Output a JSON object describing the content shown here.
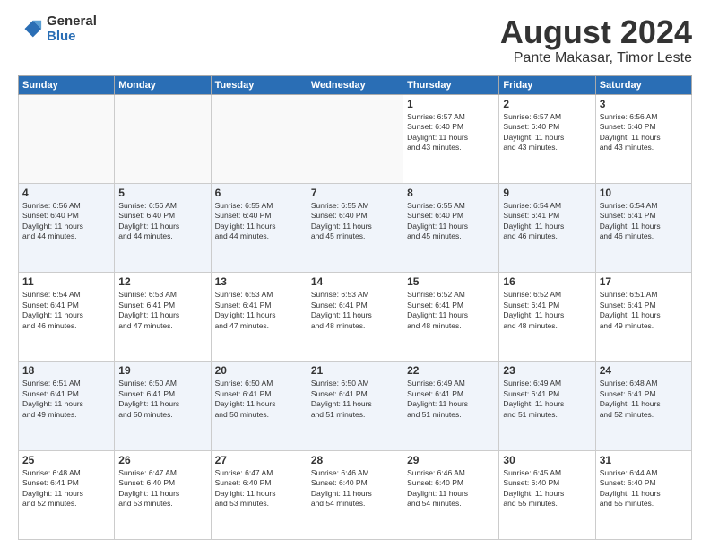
{
  "logo": {
    "general": "General",
    "blue": "Blue"
  },
  "title": "August 2024",
  "location": "Pante Makasar, Timor Leste",
  "days_of_week": [
    "Sunday",
    "Monday",
    "Tuesday",
    "Wednesday",
    "Thursday",
    "Friday",
    "Saturday"
  ],
  "weeks": [
    [
      {
        "day": "",
        "info": ""
      },
      {
        "day": "",
        "info": ""
      },
      {
        "day": "",
        "info": ""
      },
      {
        "day": "",
        "info": ""
      },
      {
        "day": "1",
        "info": "Sunrise: 6:57 AM\nSunset: 6:40 PM\nDaylight: 11 hours\nand 43 minutes."
      },
      {
        "day": "2",
        "info": "Sunrise: 6:57 AM\nSunset: 6:40 PM\nDaylight: 11 hours\nand 43 minutes."
      },
      {
        "day": "3",
        "info": "Sunrise: 6:56 AM\nSunset: 6:40 PM\nDaylight: 11 hours\nand 43 minutes."
      }
    ],
    [
      {
        "day": "4",
        "info": "Sunrise: 6:56 AM\nSunset: 6:40 PM\nDaylight: 11 hours\nand 44 minutes."
      },
      {
        "day": "5",
        "info": "Sunrise: 6:56 AM\nSunset: 6:40 PM\nDaylight: 11 hours\nand 44 minutes."
      },
      {
        "day": "6",
        "info": "Sunrise: 6:55 AM\nSunset: 6:40 PM\nDaylight: 11 hours\nand 44 minutes."
      },
      {
        "day": "7",
        "info": "Sunrise: 6:55 AM\nSunset: 6:40 PM\nDaylight: 11 hours\nand 45 minutes."
      },
      {
        "day": "8",
        "info": "Sunrise: 6:55 AM\nSunset: 6:40 PM\nDaylight: 11 hours\nand 45 minutes."
      },
      {
        "day": "9",
        "info": "Sunrise: 6:54 AM\nSunset: 6:41 PM\nDaylight: 11 hours\nand 46 minutes."
      },
      {
        "day": "10",
        "info": "Sunrise: 6:54 AM\nSunset: 6:41 PM\nDaylight: 11 hours\nand 46 minutes."
      }
    ],
    [
      {
        "day": "11",
        "info": "Sunrise: 6:54 AM\nSunset: 6:41 PM\nDaylight: 11 hours\nand 46 minutes."
      },
      {
        "day": "12",
        "info": "Sunrise: 6:53 AM\nSunset: 6:41 PM\nDaylight: 11 hours\nand 47 minutes."
      },
      {
        "day": "13",
        "info": "Sunrise: 6:53 AM\nSunset: 6:41 PM\nDaylight: 11 hours\nand 47 minutes."
      },
      {
        "day": "14",
        "info": "Sunrise: 6:53 AM\nSunset: 6:41 PM\nDaylight: 11 hours\nand 48 minutes."
      },
      {
        "day": "15",
        "info": "Sunrise: 6:52 AM\nSunset: 6:41 PM\nDaylight: 11 hours\nand 48 minutes."
      },
      {
        "day": "16",
        "info": "Sunrise: 6:52 AM\nSunset: 6:41 PM\nDaylight: 11 hours\nand 48 minutes."
      },
      {
        "day": "17",
        "info": "Sunrise: 6:51 AM\nSunset: 6:41 PM\nDaylight: 11 hours\nand 49 minutes."
      }
    ],
    [
      {
        "day": "18",
        "info": "Sunrise: 6:51 AM\nSunset: 6:41 PM\nDaylight: 11 hours\nand 49 minutes."
      },
      {
        "day": "19",
        "info": "Sunrise: 6:50 AM\nSunset: 6:41 PM\nDaylight: 11 hours\nand 50 minutes."
      },
      {
        "day": "20",
        "info": "Sunrise: 6:50 AM\nSunset: 6:41 PM\nDaylight: 11 hours\nand 50 minutes."
      },
      {
        "day": "21",
        "info": "Sunrise: 6:50 AM\nSunset: 6:41 PM\nDaylight: 11 hours\nand 51 minutes."
      },
      {
        "day": "22",
        "info": "Sunrise: 6:49 AM\nSunset: 6:41 PM\nDaylight: 11 hours\nand 51 minutes."
      },
      {
        "day": "23",
        "info": "Sunrise: 6:49 AM\nSunset: 6:41 PM\nDaylight: 11 hours\nand 51 minutes."
      },
      {
        "day": "24",
        "info": "Sunrise: 6:48 AM\nSunset: 6:41 PM\nDaylight: 11 hours\nand 52 minutes."
      }
    ],
    [
      {
        "day": "25",
        "info": "Sunrise: 6:48 AM\nSunset: 6:41 PM\nDaylight: 11 hours\nand 52 minutes."
      },
      {
        "day": "26",
        "info": "Sunrise: 6:47 AM\nSunset: 6:40 PM\nDaylight: 11 hours\nand 53 minutes."
      },
      {
        "day": "27",
        "info": "Sunrise: 6:47 AM\nSunset: 6:40 PM\nDaylight: 11 hours\nand 53 minutes."
      },
      {
        "day": "28",
        "info": "Sunrise: 6:46 AM\nSunset: 6:40 PM\nDaylight: 11 hours\nand 54 minutes."
      },
      {
        "day": "29",
        "info": "Sunrise: 6:46 AM\nSunset: 6:40 PM\nDaylight: 11 hours\nand 54 minutes."
      },
      {
        "day": "30",
        "info": "Sunrise: 6:45 AM\nSunset: 6:40 PM\nDaylight: 11 hours\nand 55 minutes."
      },
      {
        "day": "31",
        "info": "Sunrise: 6:44 AM\nSunset: 6:40 PM\nDaylight: 11 hours\nand 55 minutes."
      }
    ]
  ]
}
